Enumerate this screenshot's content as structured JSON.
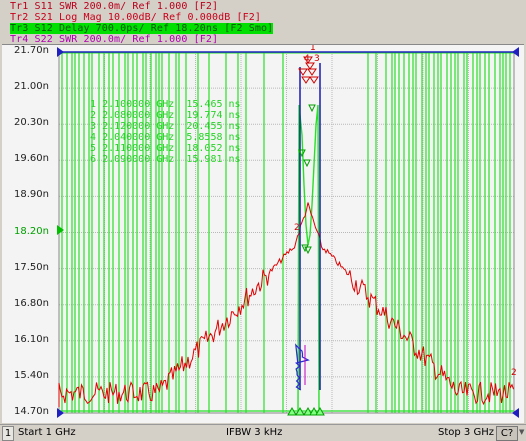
{
  "traces": [
    {
      "label": "Tr1 S11 SWR 200.0m/ Ref 1.000 [F2]",
      "color": "#c8001e"
    },
    {
      "label": "Tr2 S21 Log Mag 10.00dB/ Ref 0.000dB [F2]",
      "color": "#d0001a"
    },
    {
      "label": "Tr3 S12 Delay 700.0ps/ Ref 18.20ns [F2 Smo]",
      "color": "#00b000"
    },
    {
      "label": "Tr4 S22 SWR 200.0m/ Ref 1.000 [F2]",
      "color": "#c000c0"
    }
  ],
  "active_trace": 2,
  "y_axis": {
    "ticks": [
      "21.70n",
      "21.00n",
      "20.30n",
      "19.60n",
      "18.90n",
      "18.20n",
      "17.50n",
      "16.80n",
      "16.10n",
      "15.40n",
      "14.70n"
    ],
    "ref_tick": "18.20n"
  },
  "markers": [
    {
      "id": "1",
      "freq": "2.100000 GHz",
      "value": "15.465 ns"
    },
    {
      "id": "2",
      "freq": "2.080000 GHz",
      "value": "19.774 ns"
    },
    {
      "id": "3",
      "freq": "2.120000 GHz",
      "value": "20.455 ns"
    },
    {
      "id": "4",
      "freq": "2.040000 GHz",
      "value": "5.8558 ns"
    },
    {
      "id": "5",
      "freq": "2.110000 GHz",
      "value": "18.052 ns"
    },
    {
      "id": "6",
      "freq": "2.090000 GHz",
      "value": "15.981 ns"
    }
  ],
  "status": {
    "channel_num": "1",
    "start": "Start 1 GHz",
    "ifbw": "IFBW 3 kHz",
    "stop": "Stop 3 GHz",
    "ch_button": "C?",
    "arrow": "▼"
  },
  "colors": {
    "green": "#28e028",
    "red": "#e00000",
    "blue": "#1a1ab0",
    "magenta": "#c000c0",
    "ref_line": "#2020c0"
  }
}
